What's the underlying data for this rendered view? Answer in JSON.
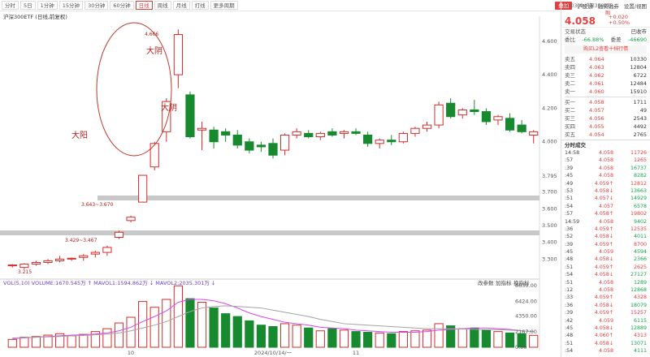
{
  "app": {
    "periods": [
      "分时",
      "5日",
      "1分钟",
      "15分钟",
      "30分钟",
      "60分钟",
      "日线",
      "周线",
      "月线",
      "打线",
      "更多周期"
    ],
    "active_period": "日线",
    "tool_btn": "叠加",
    "tools": [
      "沪股通",
      "融资融券",
      "设置/视图"
    ],
    "subtitle": "沪深300ETF (日线,前复权)"
  },
  "annotations": {
    "big_yang": "大阳",
    "big_yin1": "大阴",
    "big_yin2": "大阴",
    "high_label": "4.666",
    "range1": "3.643~3.670",
    "range2": "3.429~3.467",
    "low_label": "3.215"
  },
  "axis": {
    "price_ticks": [
      "4.600",
      "4.400",
      "4.200",
      "4.000",
      "3.795",
      "3.700",
      "3.600",
      "3.500",
      "3.400",
      "3.300"
    ],
    "vol_ticks": [
      "8630.00",
      "6424.00",
      "4350.00",
      "2167.00",
      "0.00"
    ],
    "x_labels": [
      "10",
      "2024/10/14/一",
      "11"
    ]
  },
  "volume": {
    "legend": "VOL(5,10) VOLUME:1670.545万 ↑ MAVOL1:1594.862万 ↓ MAVOL2:2035.301万 ↓",
    "tools": [
      "改参数",
      "加指标",
      "换指标"
    ]
  },
  "chart_data": {
    "type": "candlestick",
    "title": "沪深300ETF",
    "series": [
      {
        "name": "k",
        "ohlc": [
          [
            3.26,
            3.27,
            3.25,
            3.265
          ],
          [
            3.25,
            3.275,
            3.24,
            3.27
          ],
          [
            3.27,
            3.29,
            3.26,
            3.28
          ],
          [
            3.28,
            3.3,
            3.27,
            3.29
          ],
          [
            3.29,
            3.32,
            3.28,
            3.3
          ],
          [
            3.3,
            3.31,
            3.29,
            3.305
          ],
          [
            3.31,
            3.33,
            3.29,
            3.32
          ],
          [
            3.33,
            3.35,
            3.31,
            3.34
          ],
          [
            3.34,
            3.38,
            3.32,
            3.37
          ],
          [
            3.43,
            3.47,
            3.42,
            3.46
          ],
          [
            3.53,
            3.56,
            3.52,
            3.55
          ],
          [
            3.64,
            3.8,
            3.64,
            3.8
          ],
          [
            3.85,
            4.0,
            3.83,
            3.99
          ],
          [
            4.06,
            4.26,
            4.0,
            4.24
          ],
          [
            4.4,
            4.67,
            4.32,
            4.64
          ],
          [
            4.28,
            4.3,
            4.02,
            4.03
          ],
          [
            4.07,
            4.12,
            3.95,
            4.08
          ],
          [
            4.07,
            4.09,
            3.96,
            4.0
          ],
          [
            4.06,
            4.08,
            4.0,
            4.04
          ],
          [
            4.04,
            4.07,
            3.96,
            3.98
          ],
          [
            4.0,
            4.02,
            3.93,
            3.95
          ],
          [
            3.98,
            4.0,
            3.94,
            3.97
          ],
          [
            3.99,
            4.02,
            3.9,
            3.92
          ],
          [
            3.95,
            4.05,
            3.92,
            4.04
          ],
          [
            4.04,
            4.08,
            4.02,
            4.06
          ],
          [
            4.05,
            4.07,
            4.02,
            4.03
          ],
          [
            4.03,
            4.06,
            4.01,
            4.05
          ],
          [
            4.06,
            4.08,
            4.03,
            4.04
          ],
          [
            4.05,
            4.07,
            4.02,
            4.06
          ],
          [
            4.06,
            4.08,
            4.04,
            4.05
          ],
          [
            4.04,
            4.06,
            3.97,
            3.99
          ],
          [
            3.99,
            4.02,
            3.96,
            4.01
          ],
          [
            4.01,
            4.04,
            3.98,
            4.0
          ],
          [
            4.0,
            4.06,
            3.99,
            4.05
          ],
          [
            4.05,
            4.09,
            4.03,
            4.08
          ],
          [
            4.08,
            4.12,
            4.06,
            4.1
          ],
          [
            4.1,
            4.24,
            4.08,
            4.22
          ],
          [
            4.23,
            4.26,
            4.14,
            4.15
          ],
          [
            4.16,
            4.2,
            4.14,
            4.19
          ],
          [
            4.19,
            4.25,
            4.16,
            4.18
          ],
          [
            4.18,
            4.2,
            4.1,
            4.12
          ],
          [
            4.13,
            4.16,
            4.1,
            4.15
          ],
          [
            4.14,
            4.17,
            4.06,
            4.07
          ],
          [
            4.1,
            4.13,
            4.05,
            4.06
          ],
          [
            4.04,
            4.07,
            3.99,
            4.06
          ]
        ]
      },
      {
        "name": "VOL",
        "values": [
          1100,
          1400,
          1500,
          1700,
          1900,
          1600,
          1800,
          2200,
          2600,
          3400,
          4200,
          6400,
          5600,
          6700,
          8600,
          6800,
          6300,
          5500,
          4700,
          4300,
          3700,
          3100,
          2900,
          3300,
          3100,
          2700,
          2300,
          2600,
          2400,
          2200,
          2100,
          2000,
          1900,
          2200,
          2300,
          2400,
          3300,
          3000,
          2600,
          2700,
          2400,
          2200,
          2000,
          1900,
          1670
        ]
      },
      {
        "name": "MAVOL1",
        "values": [
          1200,
          1300,
          1400,
          1500,
          1600,
          1700,
          1750,
          1850,
          2000,
          2300,
          2800,
          3600,
          4300,
          5100,
          6300,
          6700,
          6700,
          6500,
          6100,
          5500,
          4800,
          4300,
          3900,
          3500,
          3300,
          3100,
          2800,
          2700,
          2600,
          2400,
          2300,
          2200,
          2100,
          2100,
          2100,
          2200,
          2400,
          2500,
          2600,
          2700,
          2700,
          2600,
          2500,
          2300,
          2200
        ]
      },
      {
        "name": "MAVOL2",
        "values": [
          1300,
          1350,
          1400,
          1450,
          1500,
          1600,
          1650,
          1750,
          1850,
          2000,
          2300,
          2700,
          3100,
          3600,
          4300,
          5000,
          5500,
          5700,
          5800,
          5700,
          5600,
          5500,
          5200,
          4900,
          4600,
          4300,
          3900,
          3600,
          3300,
          3200,
          3100,
          3000,
          2900,
          2800,
          2700,
          2600,
          2600,
          2600,
          2550,
          2500,
          2450,
          2450,
          2400,
          2300,
          2200
        ]
      }
    ],
    "ylim": [
      3.2,
      4.72
    ],
    "vol_ylim": [
      0,
      8630
    ]
  },
  "side": {
    "code": "510300 沪深300ETF",
    "status": "融",
    "price": "4.058",
    "change": "+0.020",
    "change_pct": "+0.50%",
    "trade_status_label": "交易状态",
    "trade_status": "已收市",
    "ratio_label": "委比",
    "ratio": "-66.88%",
    "diff_label": "委差",
    "diff": "-46690",
    "asks": [
      [
        "卖五",
        "4.064",
        "10330"
      ],
      [
        "卖四",
        "4.063",
        "12804"
      ],
      [
        "卖三",
        "4.062",
        "6722"
      ],
      [
        "卖二",
        "4.061",
        "12484"
      ],
      [
        "卖一",
        "4.060",
        "15910"
      ]
    ],
    "bids": [
      [
        "买一",
        "4.058",
        "1711"
      ],
      [
        "买二",
        "4.057",
        "49"
      ],
      [
        "买三",
        "4.056",
        "2543"
      ],
      [
        "买四",
        "4.055",
        "4492"
      ],
      [
        "买五",
        "4.054",
        "2765"
      ]
    ],
    "link": "购买L2查看十档行情",
    "trades_title": "分时成交",
    "trades": [
      [
        "14:58",
        "4.058",
        "11726",
        "r"
      ],
      [
        ":57",
        "4.058",
        "1265",
        "r"
      ],
      [
        ":39",
        "4.058",
        "16737",
        "g"
      ],
      [
        ":45",
        "4.058",
        "8282",
        "g"
      ],
      [
        ":49",
        "4.059↑",
        "12812",
        "r"
      ],
      [
        ":53",
        "4.058↓",
        "13663",
        "g"
      ],
      [
        ":51",
        "4.057↓",
        "14929",
        "g"
      ],
      [
        ":54",
        "4.057",
        "6578",
        "g"
      ],
      [
        ":57",
        "4.058↑",
        "19802",
        "r"
      ],
      [
        "14:59",
        "4.058",
        "9402",
        "g"
      ],
      [
        ":36",
        "4.059↑",
        "12535",
        "r"
      ],
      [
        ":52",
        "4.058↓",
        "4011",
        "g"
      ],
      [
        ":39",
        "4.059↑",
        "8700",
        "r"
      ],
      [
        ":45",
        "4.059",
        "4594",
        "g"
      ],
      [
        ":48",
        "4.058↓",
        "2366",
        "g"
      ],
      [
        ":51",
        "4.059↑",
        "2625",
        "r"
      ],
      [
        ":54",
        "4.058↓",
        "27127",
        "g"
      ],
      [
        ":51",
        "4.058",
        "1289",
        "g"
      ],
      [
        ":12",
        "4.058",
        "12868",
        "g"
      ],
      [
        ":33",
        "4.059↑",
        "4328",
        "r"
      ],
      [
        ":36",
        "4.058↓",
        "18079",
        "g"
      ],
      [
        ":39",
        "4.059↑",
        "15257",
        "r"
      ],
      [
        ":42",
        "4.059",
        "6115",
        "g"
      ],
      [
        ":45",
        "4.058↓",
        "12889",
        "g"
      ],
      [
        ":48",
        "4.060↑",
        "4313",
        "r"
      ],
      [
        ":51",
        "4.058↓",
        "13071",
        "g"
      ],
      [
        ":54",
        "4.058",
        "4111",
        "g"
      ]
    ]
  }
}
